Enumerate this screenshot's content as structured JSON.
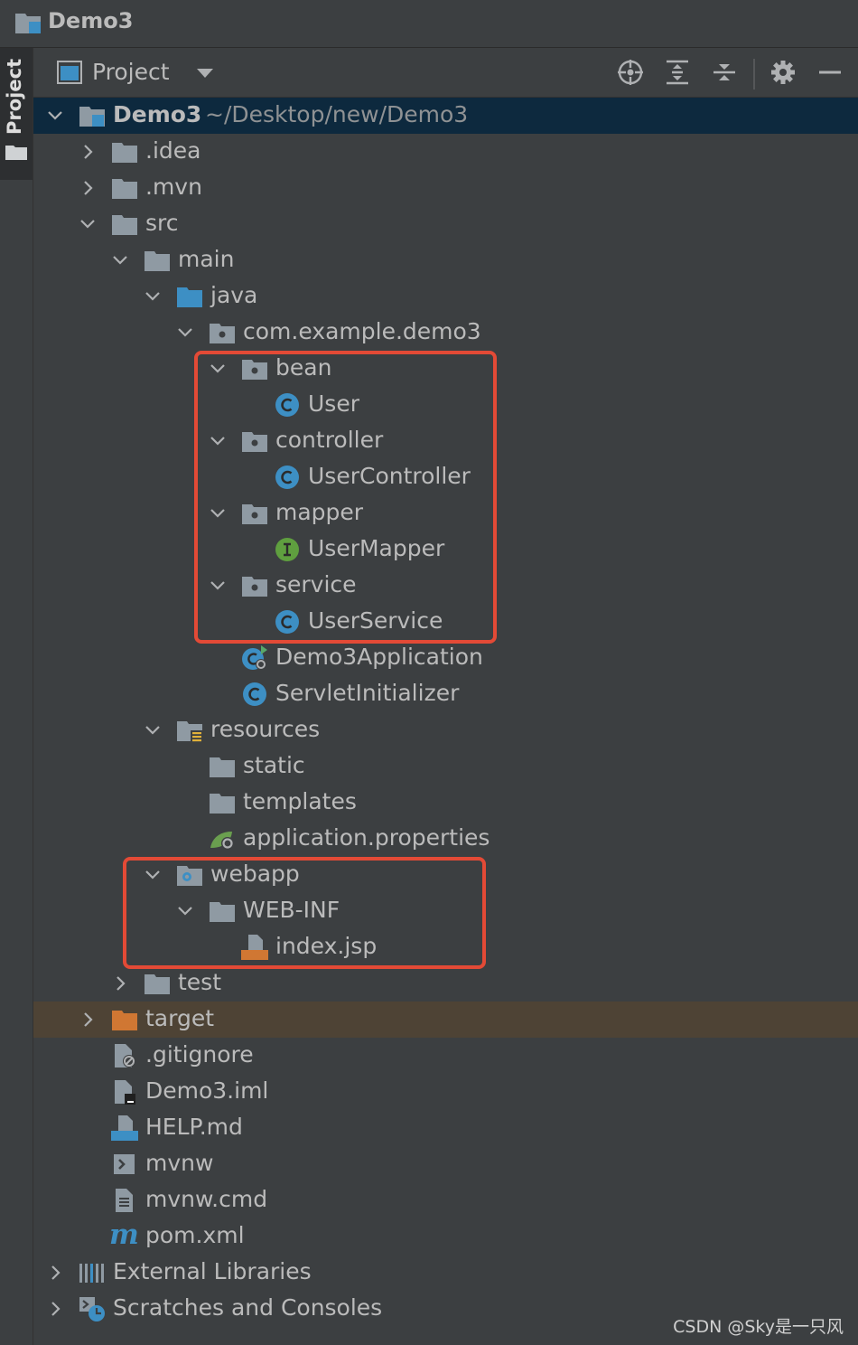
{
  "window": {
    "title": "Demo3"
  },
  "stripe": {
    "label": "Project"
  },
  "toolbar": {
    "view_label": "Project",
    "icons": [
      "crosshair-icon",
      "expand-all-icon",
      "collapse-all-icon",
      "gear-icon",
      "minimize-icon"
    ]
  },
  "tree": {
    "root": {
      "name": "Demo3",
      "path": "~/Desktop/new/Demo3"
    },
    "idea": ".idea",
    "mvn": ".mvn",
    "src": "src",
    "main": "main",
    "java": "java",
    "package": "com.example.demo3",
    "bean": "bean",
    "user": "User",
    "controller": "controller",
    "user_controller": "UserController",
    "mapper": "mapper",
    "user_mapper": "UserMapper",
    "service": "service",
    "user_service": "UserService",
    "demo3_application": "Demo3Application",
    "servlet_initializer": "ServletInitializer",
    "resources": "resources",
    "static": "static",
    "templates": "templates",
    "application_properties": "application.properties",
    "webapp": "webapp",
    "web_inf": "WEB-INF",
    "index_jsp": "index.jsp",
    "test": "test",
    "target": "target",
    "gitignore": ".gitignore",
    "iml": "Demo3.iml",
    "help_md": "HELP.md",
    "mvnw": "mvnw",
    "mvnw_cmd": "mvnw.cmd",
    "pom_xml": "pom.xml",
    "external_libraries": "External Libraries",
    "scratches": "Scratches and Consoles"
  },
  "badges": {
    "class_letter": "C",
    "interface_letter": "I",
    "jsp_badge": "JSP",
    "md_badge": "MD",
    "maven_letter": "m"
  },
  "watermark": "CSDN @Sky是一只风",
  "colors": {
    "background": "#3c3f41",
    "selection": "#0d293e",
    "excluded_row": "#4e4335",
    "highlight_box": "#e34a36",
    "folder": "#8f9aa3",
    "source_folder": "#3d8fc4",
    "class_icon": "#3d8fc4",
    "interface_icon": "#5f9f3f",
    "excluded_folder": "#d07733"
  }
}
